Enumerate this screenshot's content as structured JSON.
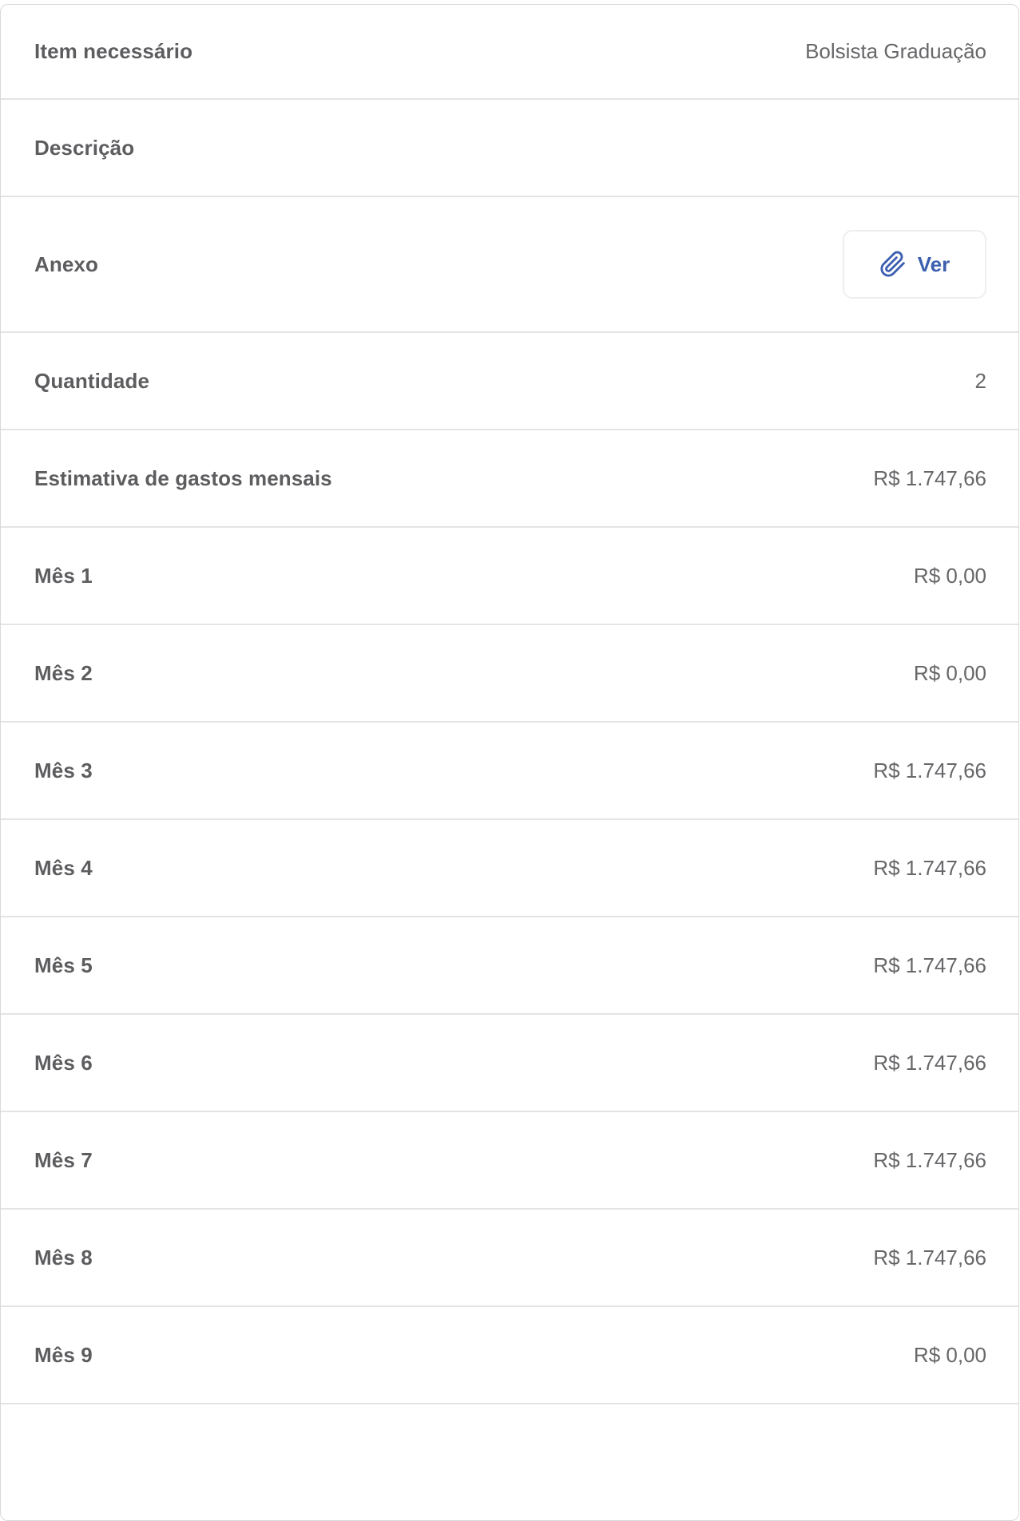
{
  "details": {
    "item": {
      "label": "Item necessário",
      "value": "Bolsista Graduação"
    },
    "descricao": {
      "label": "Descrição",
      "value": ""
    },
    "anexo": {
      "label": "Anexo",
      "button_label": "Ver",
      "icon": "paperclip-icon"
    },
    "quantidade": {
      "label": "Quantidade",
      "value": "2"
    },
    "estimativa": {
      "label": "Estimativa de gastos mensais",
      "value": "R$ 1.747,66"
    },
    "months": [
      {
        "label": "Mês 1",
        "value": "R$ 0,00"
      },
      {
        "label": "Mês 2",
        "value": "R$ 0,00"
      },
      {
        "label": "Mês 3",
        "value": "R$ 1.747,66"
      },
      {
        "label": "Mês 4",
        "value": "R$ 1.747,66"
      },
      {
        "label": "Mês 5",
        "value": "R$ 1.747,66"
      },
      {
        "label": "Mês 6",
        "value": "R$ 1.747,66"
      },
      {
        "label": "Mês 7",
        "value": "R$ 1.747,66"
      },
      {
        "label": "Mês 8",
        "value": "R$ 1.747,66"
      },
      {
        "label": "Mês 9",
        "value": "R$ 0,00"
      }
    ]
  },
  "colors": {
    "label": "#5d5d60",
    "value": "#67676a",
    "accent": "#3d5fb0",
    "divider": "#e4e4e6",
    "border": "#d9d9d9"
  }
}
